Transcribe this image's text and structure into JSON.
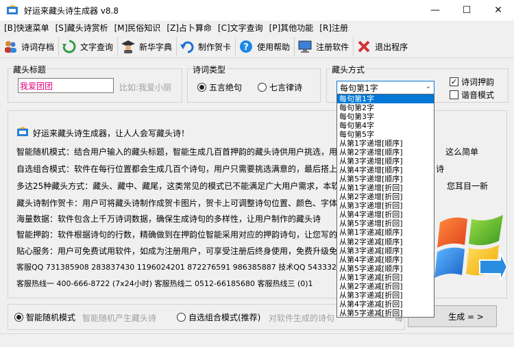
{
  "window": {
    "title": "好运来藏头诗生成器 v8.8",
    "controls": [
      "—",
      "☐",
      "✕"
    ]
  },
  "menu": [
    "[B]快速菜单",
    "[S]藏头诗赏析",
    "[M]民俗知识",
    "[Z]占卜算命",
    "[C]文字查询",
    "[P]其他功能",
    "[R]注册"
  ],
  "toolbar": [
    {
      "label": "诗词存档",
      "icon": "people-icon"
    },
    {
      "label": "文字查询",
      "icon": "refresh-icon"
    },
    {
      "label": "新华字典",
      "icon": "graduate-icon"
    },
    {
      "label": "制作贺卡",
      "icon": "undo-arrow-icon"
    },
    {
      "label": "使用帮助",
      "icon": "help-icon"
    },
    {
      "label": "注册软件",
      "icon": "monitor-icon"
    },
    {
      "label": "退出程序",
      "icon": "close-x-icon"
    }
  ],
  "title_group": {
    "label": "藏头标题",
    "value": "我爱团团",
    "placeholder_hint": "比如:我爱小丽"
  },
  "poem_type": {
    "label": "诗词类型",
    "options": [
      "五言绝句",
      "七言律诗"
    ],
    "selected": 0
  },
  "head_mode": {
    "label": "藏头方式",
    "selected_value": "每句第1字",
    "options": [
      "每句第1字",
      "每句第2字",
      "每句第3字",
      "每句第4字",
      "每句第5字",
      "从第1字递增[顺序]",
      "从第2字递增[顺序]",
      "从第3字递增[顺序]",
      "从第4字递增[顺序]",
      "从第5字递增[顺序]",
      "从第1字递增[折回]",
      "从第2字递增[折回]",
      "从第3字递增[折回]",
      "从第4字递增[折回]",
      "从第5字递增[折回]",
      "从第1字递减[顺序]",
      "从第2字递减[顺序]",
      "从第3字递减[顺序]",
      "从第4字递减[顺序]",
      "从第5字递减[顺序]",
      "从第1字递减[折回]",
      "从第2字递减[折回]",
      "从第3字递减[折回]",
      "从第4字递减[折回]",
      "从第5字递减[折回]"
    ]
  },
  "checks": [
    {
      "label": "诗词押韵",
      "checked": true
    },
    {
      "label": "谐音模式",
      "checked": false
    }
  ],
  "info": {
    "headline": "好运来藏头诗生成器，让人人会写藏头诗！",
    "lines": [
      "智能随机模式：结合用户输入的藏头标题，智能生成几百首押韵的藏头诗供用户挑选，用",
      "自选组合模式：软件在每行位置都会生成几百个诗句，用户只需要挑选满意的，最后搭上",
      "多达25种藏头方式：藏头、藏中、藏尾，这类常见的模式已不能满足广大用户需求，本软",
      "藏头诗制作贺卡：用户可将藏头诗制作成贺卡图片，贺卡上可调整诗句位置、颜色、字体",
      "海量数据：软件包含上千万诗词数据，确保生成诗句的多样性，让用户制作的藏头诗",
      "智能押韵：软件根据诗句的行数，精确做到在押韵位智能采用对应的押韵诗句，让您写的",
      "贴心服务：用户可免费试用软件，如成为注册用户，可享受注册后终身使用，免费升级免",
      "客服QQ  731385908  283837430  1196024201  872276591  986385887  技术QQ 54333222",
      "客服热线一 400-666-8722 (7x24小时)   客服热线二 0512-66185680   客服热线三 (0)1"
    ],
    "overflow_right": [
      "这么简单",
      "诗",
      "您耳目一新"
    ]
  },
  "bottom": {
    "mode1_label": "智能随机模式",
    "mode1_hint": "智能随机产生藏头诗",
    "mode2_label": "自选组合模式(推荐)",
    "mode2_hint": "对软件生成的诗句",
    "mode2_hint_tail": "每",
    "generate_label": "生成 = >"
  },
  "colors": {
    "accent": "#0078d7",
    "title_value": "#e4007f"
  }
}
